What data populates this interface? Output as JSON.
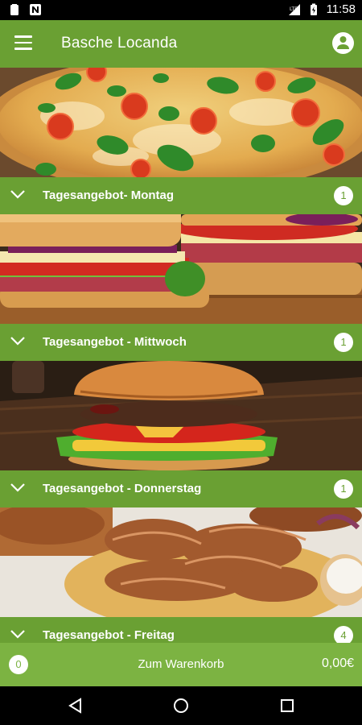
{
  "status_bar": {
    "time": "11:58",
    "icons": [
      "notification-icon",
      "n-app-icon",
      "signal-icon",
      "battery-icon"
    ]
  },
  "app_bar": {
    "title": "Basche Locanda",
    "menu_icon": "menu-icon",
    "account_icon": "account-icon"
  },
  "sections": [
    {
      "label": "Tagesangebot- Montag",
      "count": "1",
      "image": "pizza"
    },
    {
      "label": "Tagesangebot - Mittwoch",
      "count": "1",
      "image": "sandwich"
    },
    {
      "label": "Tagesangebot - Donnerstag",
      "count": "1",
      "image": "burger"
    },
    {
      "label": "Tagesangebot - Freitag",
      "count": "4",
      "image": "doner"
    }
  ],
  "cart": {
    "quantity": "0",
    "label": "Zum Warenkorb",
    "total": "0,00€"
  },
  "colors": {
    "primary": "#6aa033",
    "cart": "#7cb342"
  }
}
